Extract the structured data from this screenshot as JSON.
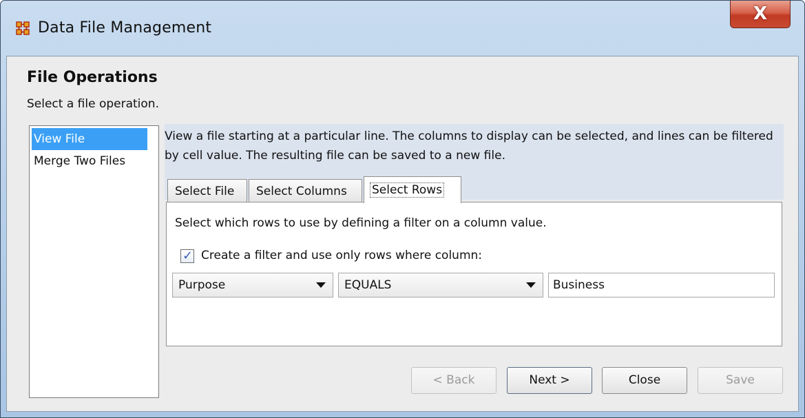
{
  "window": {
    "title": "Data File Management",
    "close_label": "X"
  },
  "header": {
    "title": "File Operations",
    "subtitle": "Select a file operation."
  },
  "operations": [
    {
      "label": "View File",
      "selected": true
    },
    {
      "label": "Merge Two Files",
      "selected": false
    }
  ],
  "description": "View a file starting at a particular line. The columns to display can be selected, and lines can be filtered by cell value. The resulting file can be saved to a new file.",
  "tabs": [
    {
      "label": "Select File",
      "active": false
    },
    {
      "label": "Select Columns",
      "active": false
    },
    {
      "label": "Select Rows",
      "active": true
    }
  ],
  "select_rows": {
    "instruction": "Select which rows to use by defining a filter on a column value.",
    "filter_checkbox": {
      "label": "Create a filter and use only rows where column:",
      "checked": true
    },
    "column_select": "Purpose",
    "operator_select": "EQUALS",
    "value_field": "Business"
  },
  "buttons": {
    "back": "< Back",
    "next": "Next >",
    "close": "Close",
    "save": "Save"
  },
  "colors": {
    "selection": "#3ba0f5",
    "close_button": "#c84a32",
    "description_bg": "#dbe3ee"
  }
}
